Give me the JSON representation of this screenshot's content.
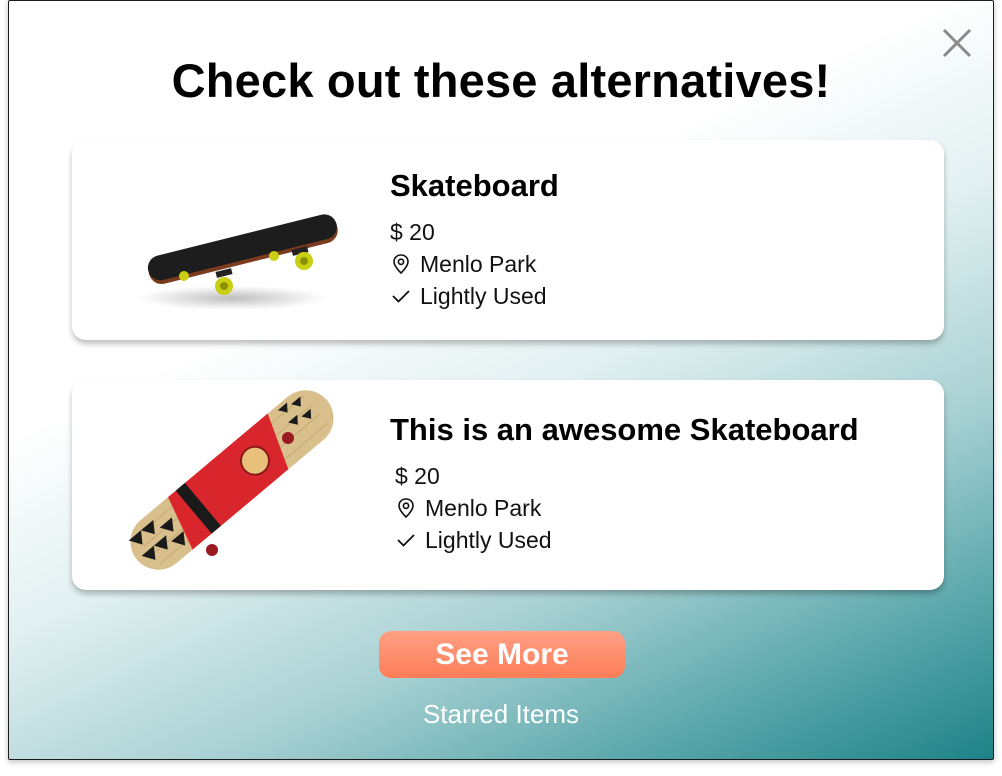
{
  "modal": {
    "title": "Check out these alternatives!",
    "close_icon": "close-icon"
  },
  "items": [
    {
      "title": "Skateboard",
      "price": "$ 20",
      "location": "Menlo Park",
      "condition": "Lightly Used",
      "image": "black-skateboard-image"
    },
    {
      "title": "This is an awesome Skateboard",
      "price": "$ 20",
      "location": "Menlo Park",
      "condition": "Lightly Used",
      "image": "red-pattern-skateboard-image"
    }
  ],
  "actions": {
    "see_more_label": "See More",
    "starred_label": "Starred Items"
  },
  "colors": {
    "accent_button": "#fd7d58",
    "gradient_end": "#1e8288"
  }
}
